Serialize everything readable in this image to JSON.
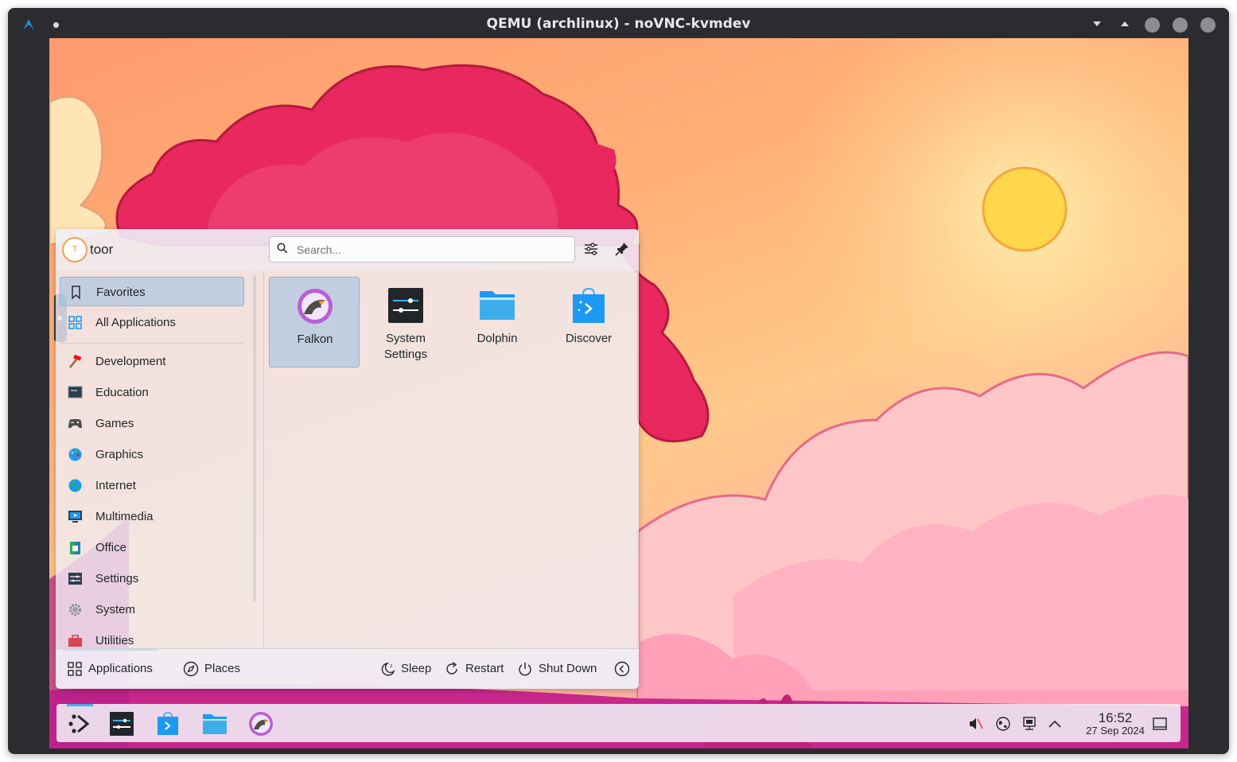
{
  "window": {
    "title": "QEMU (archlinux) - noVNC-kvmdev"
  },
  "menu": {
    "user": {
      "avatar_letter": "T",
      "name": "toor"
    },
    "search": {
      "placeholder": "Search..."
    },
    "categories": [
      {
        "label": "Favorites",
        "icon": "bookmark-icon",
        "selected": true
      },
      {
        "label": "All Applications",
        "icon": "grid-icon"
      },
      {
        "label": "Development",
        "icon": "hammer-icon"
      },
      {
        "label": "Education",
        "icon": "chalkboard-icon"
      },
      {
        "label": "Games",
        "icon": "gamepad-icon"
      },
      {
        "label": "Graphics",
        "icon": "palette-icon"
      },
      {
        "label": "Internet",
        "icon": "globe-icon"
      },
      {
        "label": "Multimedia",
        "icon": "monitor-play-icon"
      },
      {
        "label": "Office",
        "icon": "office-icon"
      },
      {
        "label": "Settings",
        "icon": "settings-sliders-icon"
      },
      {
        "label": "System",
        "icon": "gear-icon"
      },
      {
        "label": "Utilities",
        "icon": "toolbox-icon"
      }
    ],
    "apps": [
      {
        "label": "Falkon",
        "icon": "falkon-icon",
        "selected": true
      },
      {
        "label": "System Settings",
        "icon": "system-settings-icon"
      },
      {
        "label": "Dolphin",
        "icon": "dolphin-folder-icon"
      },
      {
        "label": "Discover",
        "icon": "discover-bag-icon"
      }
    ],
    "footer": {
      "applications": "Applications",
      "places": "Places",
      "sleep": "Sleep",
      "restart": "Restart",
      "shutdown": "Shut Down"
    }
  },
  "taskbar": {
    "clock": {
      "time": "16:52",
      "date": "27 Sep 2024"
    },
    "tasks": [
      "application-launcher-icon",
      "system-settings-icon",
      "discover-bag-icon",
      "dolphin-folder-icon",
      "falkon-icon"
    ],
    "tray": [
      "muted-speaker-icon",
      "network-globe-icon",
      "display-icon",
      "chevron-up-icon",
      "show-desktop-icon"
    ]
  },
  "colors": {
    "accent": "#3daee9",
    "titlebar": "#2b2c30",
    "selection": "#99c0e1"
  }
}
